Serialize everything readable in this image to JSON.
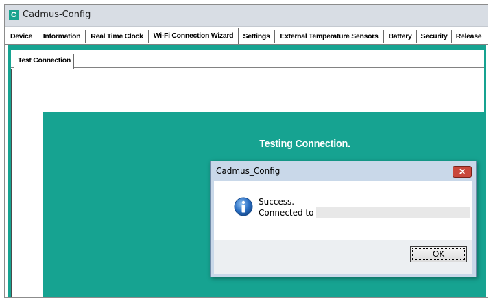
{
  "window": {
    "title": "Cadmus-Config",
    "app_icon_letter": "C"
  },
  "tabs": [
    {
      "label": "Device"
    },
    {
      "label": "Information"
    },
    {
      "label": "Real Time Clock"
    },
    {
      "label": "Wi-Fi Connection Wizard",
      "active": true
    },
    {
      "label": "Settings"
    },
    {
      "label": "External Temperature Sensors"
    },
    {
      "label": "Battery"
    },
    {
      "label": "Security"
    },
    {
      "label": "Release"
    }
  ],
  "subtabs": [
    {
      "label": "Test Connection",
      "active": true
    }
  ],
  "content": {
    "status_text": "Testing Connection."
  },
  "dialog": {
    "title": "Cadmus_Config",
    "close_symbol": "✕",
    "message_line1": "Success.",
    "message_line2": "Connected to",
    "connected_value": "",
    "ok_label": "OK"
  },
  "colors": {
    "accent_teal": "#16a391",
    "close_red": "#c9473b",
    "info_blue": "#2a6fc4"
  }
}
